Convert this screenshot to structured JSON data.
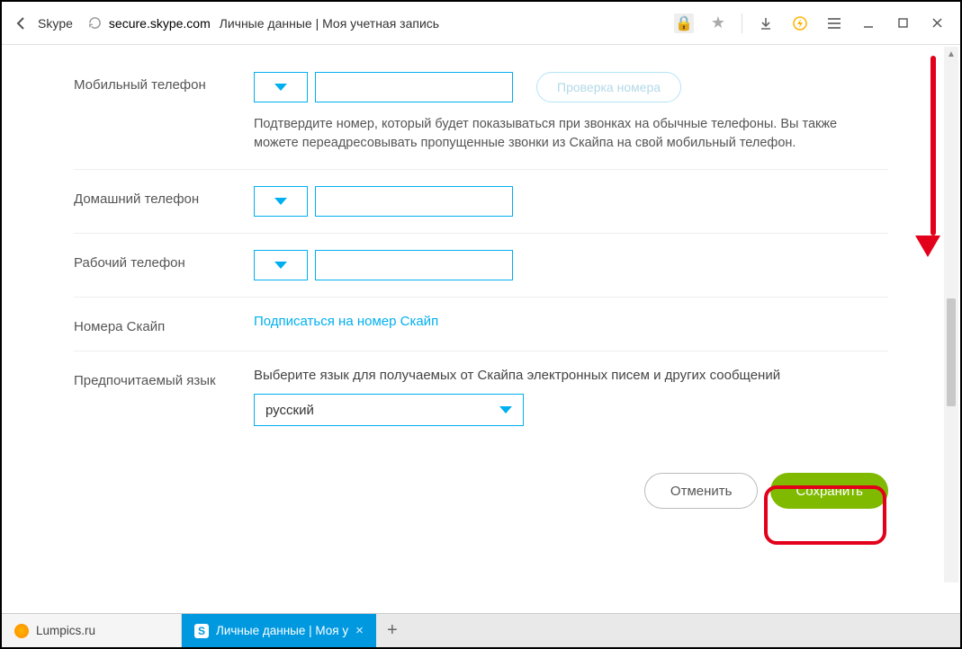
{
  "browser": {
    "back_label": "Skype",
    "url_domain": "secure.skype.com",
    "url_title": "Личные данные | Моя учетная запись"
  },
  "form": {
    "mobile": {
      "label": "Мобильный телефон",
      "verify": "Проверка номера",
      "help": "Подтвердите номер, который будет показываться при звонках на обычные телефоны. Вы также можете переадресовывать пропущенные звонки из Скайпа на свой мобильный телефон."
    },
    "home": {
      "label": "Домашний телефон"
    },
    "work": {
      "label": "Рабочий телефон"
    },
    "skype_numbers": {
      "label": "Номера Скайп",
      "link": "Подписаться на номер Скайп"
    },
    "language": {
      "label": "Предпочитаемый язык",
      "desc": "Выберите язык для получаемых от Скайпа электронных писем и других сообщений",
      "value": "русский"
    }
  },
  "actions": {
    "cancel": "Отменить",
    "save": "Сохранить"
  },
  "tabs": {
    "inactive": "Lumpics.ru",
    "active": "Личные данные | Моя у",
    "skype_letter": "S"
  }
}
